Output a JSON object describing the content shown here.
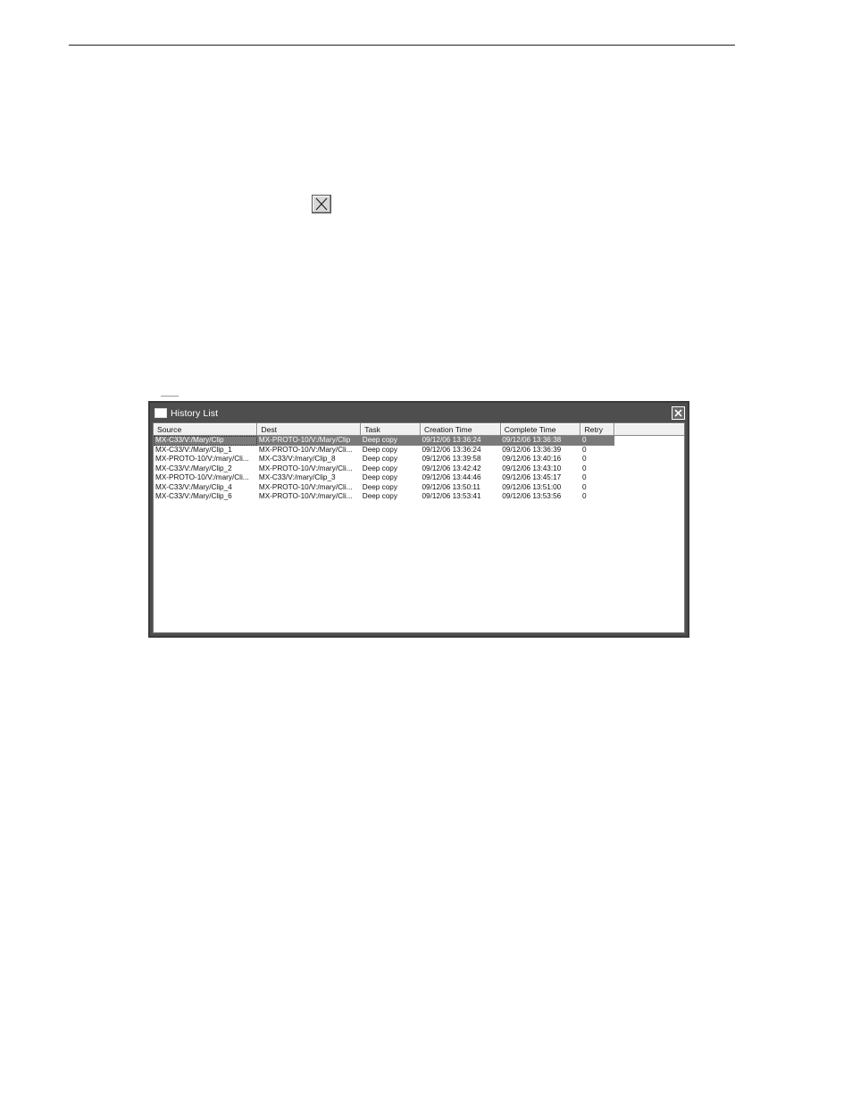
{
  "window": {
    "title": "History List",
    "close_label": "Close"
  },
  "columns": [
    "Source",
    "Dest",
    "Task",
    "Creation Time",
    "Complete Time",
    "Retry"
  ],
  "rows": [
    {
      "source": "MX-C33/V:/Mary/Clip",
      "dest": "MX-PROTO-10/V:/Mary/Clip",
      "task": "Deep copy",
      "creation": "09/12/06 13:36:24",
      "complete": "09/12/06 13:36:38",
      "retry": "0",
      "selected": true
    },
    {
      "source": "MX-C33/V:/Mary/Clip_1",
      "dest": "MX-PROTO-10/V:/Mary/Cli...",
      "task": "Deep copy",
      "creation": "09/12/06 13:36:24",
      "complete": "09/12/06 13:36:39",
      "retry": "0",
      "selected": false
    },
    {
      "source": "MX-PROTO-10/V:/mary/Cli...",
      "dest": "MX-C33/V:/mary/Clip_8",
      "task": "Deep copy",
      "creation": "09/12/06 13:39:58",
      "complete": "09/12/06 13:40:16",
      "retry": "0",
      "selected": false
    },
    {
      "source": "MX-C33/V:/Mary/Clip_2",
      "dest": "MX-PROTO-10/V:/mary/Cli...",
      "task": "Deep copy",
      "creation": "09/12/06 13:42:42",
      "complete": "09/12/06 13:43:10",
      "retry": "0",
      "selected": false
    },
    {
      "source": "MX-PROTO-10/V:/mary/Cli...",
      "dest": "MX-C33/V:/mary/Clip_3",
      "task": "Deep copy",
      "creation": "09/12/06 13:44:46",
      "complete": "09/12/06 13:45:17",
      "retry": "0",
      "selected": false
    },
    {
      "source": "MX-C33/V:/Mary/Clip_4",
      "dest": "MX-PROTO-10/V:/mary/Cli...",
      "task": "Deep copy",
      "creation": "09/12/06 13:50:11",
      "complete": "09/12/06 13:51:00",
      "retry": "0",
      "selected": false
    },
    {
      "source": "MX-C33/V:/Mary/Clip_6",
      "dest": "MX-PROTO-10/V:/mary/Cli...",
      "task": "Deep copy",
      "creation": "09/12/06 13:53:41",
      "complete": "09/12/06 13:53:56",
      "retry": "0",
      "selected": false
    }
  ],
  "icons": {
    "inline_close": "close-x-icon",
    "window_icon": "window-icon",
    "window_close": "close-icon"
  }
}
